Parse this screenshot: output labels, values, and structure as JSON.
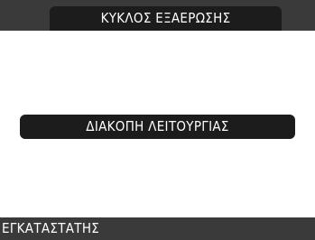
{
  "header": {
    "title": "ΚΥΚΛΟΣ ΕΞΑΕΡΩΣΗΣ"
  },
  "main": {
    "status_label": "ΔΙΑΚΟΠΗ ΛΕΙΤΟΥΡΓΙΑΣ"
  },
  "footer": {
    "label": "ΕΓΚΑΤΑΣΤΑΤΗΣ"
  },
  "colors": {
    "bar_background": "#3a3a3a",
    "pill_background": "#1c1c1c",
    "screen_background": "#ffffff",
    "text": "#ffffff"
  }
}
